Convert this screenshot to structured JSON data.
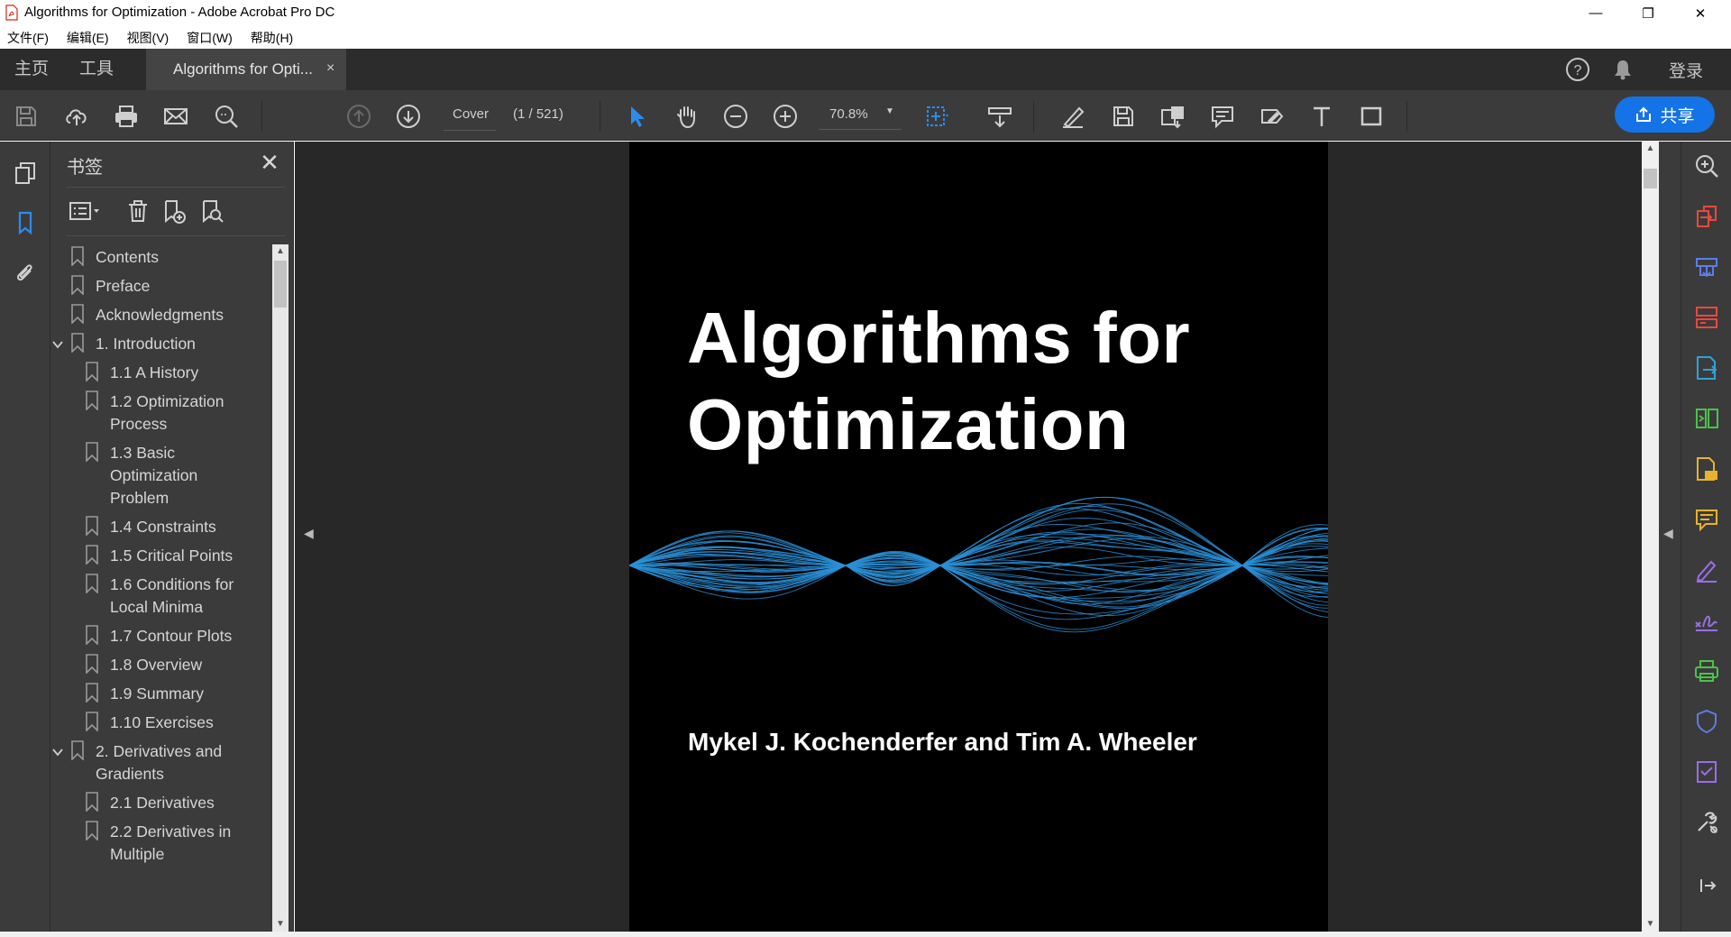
{
  "window": {
    "title": "Algorithms for Optimization - Adobe Acrobat Pro DC",
    "minimize": "—",
    "restore": "❐",
    "close": "✕"
  },
  "menu": [
    "文件(F)",
    "编辑(E)",
    "视图(V)",
    "窗口(W)",
    "帮助(H)"
  ],
  "tabs": {
    "home": "主页",
    "tools": "工具",
    "document": "Algorithms for Opti...",
    "document_close": "×",
    "help": "?",
    "signin": "登录"
  },
  "toolbar": {
    "page_label": "Cover",
    "page_count": "(1 / 521)",
    "zoom": "70.8%",
    "share_label": "共享"
  },
  "bookmarks_panel": {
    "title": "书签",
    "close": "✕",
    "items": [
      {
        "label": "Contents",
        "level": 0,
        "expanded": null
      },
      {
        "label": "Preface",
        "level": 0,
        "expanded": null
      },
      {
        "label": "Acknowledgments",
        "level": 0,
        "expanded": null
      },
      {
        "label": "1. Introduction",
        "level": 0,
        "expanded": true
      },
      {
        "label": "1.1 A History",
        "level": 1,
        "expanded": null
      },
      {
        "label": "1.2 Optimization\nProcess",
        "level": 1,
        "expanded": null
      },
      {
        "label": "1.3 Basic\nOptimization\nProblem",
        "level": 1,
        "expanded": null
      },
      {
        "label": "1.4 Constraints",
        "level": 1,
        "expanded": null
      },
      {
        "label": "1.5 Critical Points",
        "level": 1,
        "expanded": null
      },
      {
        "label": "1.6 Conditions for\nLocal Minima",
        "level": 1,
        "expanded": null
      },
      {
        "label": "1.7 Contour Plots",
        "level": 1,
        "expanded": null
      },
      {
        "label": "1.8 Overview",
        "level": 1,
        "expanded": null
      },
      {
        "label": "1.9 Summary",
        "level": 1,
        "expanded": null
      },
      {
        "label": "1.10 Exercises",
        "level": 1,
        "expanded": null
      },
      {
        "label": "2. Derivatives and\nGradients",
        "level": 0,
        "expanded": true
      },
      {
        "label": "2.1 Derivatives",
        "level": 1,
        "expanded": null
      },
      {
        "label": "2.2 Derivatives in\nMultiple",
        "level": 1,
        "expanded": null
      }
    ]
  },
  "document": {
    "title_line1": "Algorithms for",
    "title_line2": "Optimization",
    "authors": "Mykel J. Kochenderfer and Tim A. Wheeler"
  },
  "colors": {
    "accent": "#1473e6",
    "wave": "#2a8fd6"
  }
}
